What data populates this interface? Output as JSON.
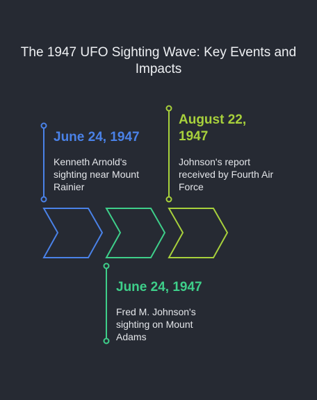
{
  "title": "The 1947 UFO Sighting Wave: Key Events and Impacts",
  "colors": {
    "background": "#262a33",
    "event_1": "#4a82e8",
    "event_2": "#3ecf8a",
    "event_3": "#a8d13c"
  },
  "events": [
    {
      "date": "June 24, 1947",
      "description": "Kenneth Arnold's sighting near Mount Rainier"
    },
    {
      "date": "June 24, 1947",
      "description": "Fred M. Johnson's sighting on Mount Adams"
    },
    {
      "date": "August 22, 1947",
      "description": "Johnson's report received by Fourth Air Force"
    }
  ]
}
